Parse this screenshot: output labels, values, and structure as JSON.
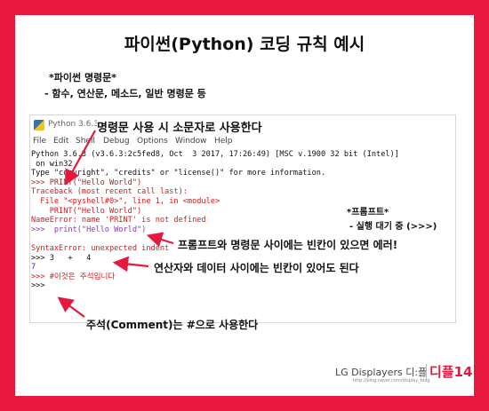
{
  "title": "파이썬(Python) 코딩 규칙 예시",
  "intro": {
    "line1": "*파이썬 명령문*",
    "line2": "- 함수, 연산문, 메소드, 일반 명령문 등"
  },
  "idle": {
    "window_title": "Python 3.6.3",
    "menu": [
      "File",
      "Edit",
      "Shell",
      "Debug",
      "Options",
      "Window",
      "Help"
    ],
    "lines": [
      {
        "text": "Python 3.6.3 (v3.6.3:2c5fed8, Oct  3 2017, 17:26:49) [MSC v.1900 32 bit (Intel)]",
        "color": "k"
      },
      {
        "text": " on win32",
        "color": "k"
      },
      {
        "text": "Type \"copyright\", \"credits\" or \"license()\" for more information.",
        "color": "k"
      },
      {
        "text": ">>> PRINT(\"Hello World\")",
        "color": "p"
      },
      {
        "text": "Traceback (most recent call last):",
        "color": "r"
      },
      {
        "text": "  File \"<pyshell#0>\", line 1, in <module>",
        "color": "r"
      },
      {
        "text": "    PRINT(\"Hello World\")",
        "color": "r"
      },
      {
        "text": "NameError: name 'PRINT' is not defined",
        "color": "r"
      },
      {
        "text": ">>>  print(\"Hello World\")",
        "color": "pu"
      },
      {
        "text": "",
        "color": "k"
      },
      {
        "text": "SyntaxError: unexpected indent",
        "color": "r"
      },
      {
        "text": ">>> 3   +   4",
        "color": "k"
      },
      {
        "text": "7",
        "color": "b"
      },
      {
        "text": ">>> #이것은 주석입니다",
        "color": "r"
      },
      {
        "text": ">>>",
        "color": "k"
      }
    ]
  },
  "annotations": {
    "lowercase": "명령문 사용 시 소문자로 사용한다",
    "prompt_title": "*프롬프트*",
    "prompt_desc": "- 실행 대기 중 (>>>)",
    "space_error": "프롬프트와 명령문 사이에는 빈칸이 있으면 에러!",
    "space_ok": "연산자와 데이터 사이에는 빈칸이 있어도 된다",
    "comment": "주석(Comment)는 #으로 사용한다"
  },
  "footer": {
    "brand": "LG Displayers 디:플",
    "url": "http://blog.naver.com/display_blog",
    "mark": "디플14"
  },
  "colors": {
    "frame": "#e8173d",
    "error": "#d61a1a",
    "output": "#1b35c4"
  }
}
